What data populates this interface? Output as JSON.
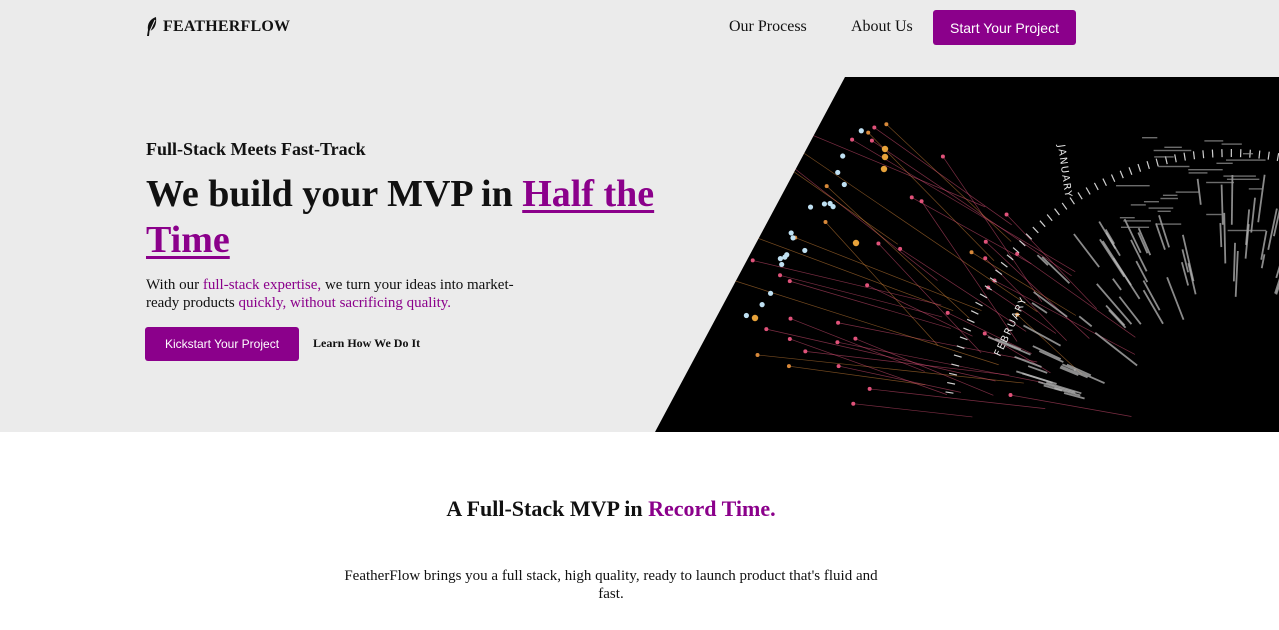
{
  "brand": {
    "name": "FEATHERFLOW",
    "icon": "feather-icon"
  },
  "nav": {
    "links": [
      "Our Process",
      "About Us"
    ],
    "cta_label": "Start Your Project"
  },
  "hero": {
    "eyebrow": "Full-Stack Meets Fast-Track",
    "headline_prefix": "We build your MVP in ",
    "headline_accent": "Half the Time",
    "lead": {
      "t1": "With our ",
      "h1": "full-stack expertise,",
      "t2": " we turn your ideas into market-ready products ",
      "h2": "quickly, without sacrificing quality."
    },
    "primary_button": "Kickstart Your Project",
    "secondary_link": "Learn How We Do It",
    "art_months": [
      "JANUARY",
      "FEBRUARY"
    ]
  },
  "section": {
    "title_prefix": "A Full-Stack MVP in ",
    "title_accent": "Record Time.",
    "description": "FeatherFlow brings you a full stack, high quality, ready to launch product that's fluid and fast."
  },
  "colors": {
    "accent": "#8b008b",
    "hero_bg": "#ebebeb",
    "art_bg": "#000000"
  }
}
